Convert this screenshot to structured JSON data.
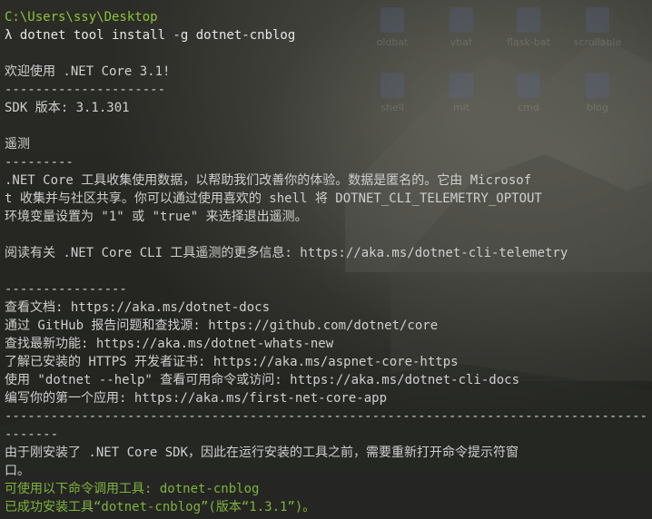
{
  "window": {
    "theme": {
      "background": "#272822",
      "foreground": "#cfcfcf",
      "prompt_path_color": "#8fc33a",
      "success_color": "#7fb33e"
    }
  },
  "desktop_icons": [
    {
      "label": "oldbat",
      "icon": "folder-icon"
    },
    {
      "label": "vbat",
      "icon": "folder-icon"
    },
    {
      "label": "flask-bat",
      "icon": "folder-icon"
    },
    {
      "label": "scrollable",
      "icon": "folder-icon"
    },
    {
      "label": "shell",
      "icon": "shortcut-icon"
    },
    {
      "label": "mit",
      "icon": "shortcut-icon"
    },
    {
      "label": "cmd",
      "icon": "shortcut-icon"
    },
    {
      "label": "blog",
      "icon": "shortcut-icon"
    }
  ],
  "terminal": {
    "lines": [
      {
        "text": "C:\\Users\\ssy\\Desktop",
        "style": "path"
      },
      {
        "text": "λ dotnet tool install -g dotnet-cnblog",
        "style": "prompt"
      },
      {
        "text": "",
        "style": "text"
      },
      {
        "text": "欢迎使用 .NET Core 3.1!",
        "style": "text"
      },
      {
        "text": "---------------------",
        "style": "text"
      },
      {
        "text": "SDK 版本: 3.1.301",
        "style": "text"
      },
      {
        "text": "",
        "style": "text"
      },
      {
        "text": "遥测",
        "style": "text"
      },
      {
        "text": "---------",
        "style": "text"
      },
      {
        "text": ".NET Core 工具收集使用数据，以帮助我们改善你的体验。数据是匿名的。它由 Microsof",
        "style": "text"
      },
      {
        "text": "t 收集并与社区共享。你可以通过使用喜欢的 shell 将 DOTNET_CLI_TELEMETRY_OPTOUT",
        "style": "text"
      },
      {
        "text": "环境变量设置为 \"1\" 或 \"true\" 来选择退出遥测。",
        "style": "text"
      },
      {
        "text": "",
        "style": "text"
      },
      {
        "text": "阅读有关 .NET Core CLI 工具遥测的更多信息: https://aka.ms/dotnet-cli-telemetry",
        "style": "text"
      },
      {
        "text": "",
        "style": "text"
      },
      {
        "text": "----------------",
        "style": "text"
      },
      {
        "text": "查看文档: https://aka.ms/dotnet-docs",
        "style": "text"
      },
      {
        "text": "通过 GitHub 报告问题和查找源: https://github.com/dotnet/core",
        "style": "text"
      },
      {
        "text": "查找最新功能: https://aka.ms/dotnet-whats-new",
        "style": "text"
      },
      {
        "text": "了解已安装的 HTTPS 开发者证书: https://aka.ms/aspnet-core-https",
        "style": "text"
      },
      {
        "text": "使用 \"dotnet --help\" 查看可用命令或访问: https://aka.ms/dotnet-cli-docs",
        "style": "text"
      },
      {
        "text": "编写你的第一个应用: https://aka.ms/first-net-core-app",
        "style": "text"
      },
      {
        "text": "------------------------------------------------------------------------------------",
        "style": "text"
      },
      {
        "text": "-------",
        "style": "text"
      },
      {
        "text": "由于刚安装了 .NET Core SDK，因此在运行安装的工具之前，需要重新打开命令提示符窗",
        "style": "text"
      },
      {
        "text": "口。",
        "style": "text"
      },
      {
        "text": "可使用以下命令调用工具: dotnet-cnblog",
        "style": "green"
      },
      {
        "text": "已成功安装工具“dotnet-cnblog”(版本“1.3.1”)。",
        "style": "green"
      }
    ]
  }
}
